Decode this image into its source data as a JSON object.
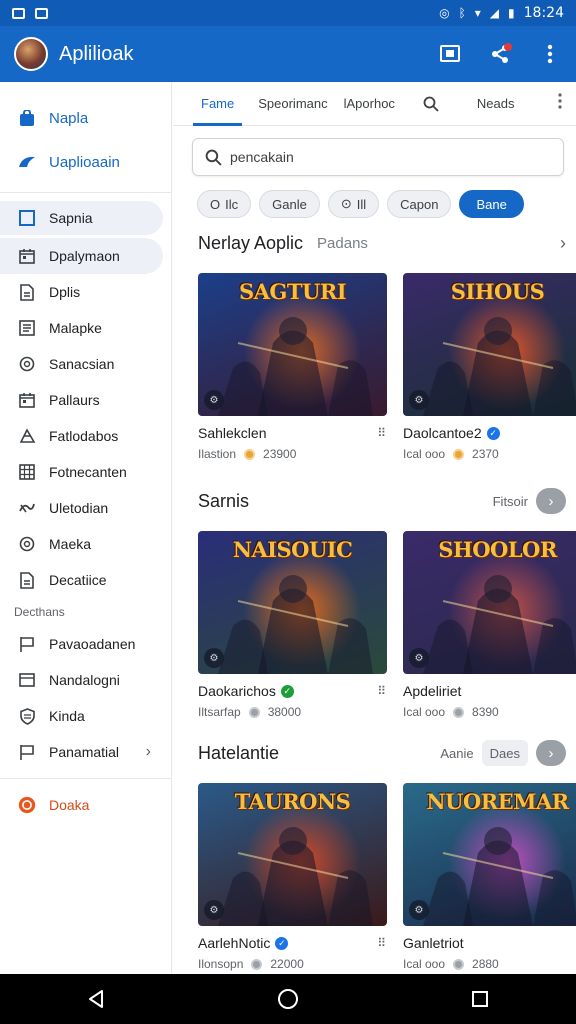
{
  "status_bar": {
    "time": "18:24"
  },
  "app_bar": {
    "title": "Aplilioak"
  },
  "sidebar": {
    "items_top": [
      {
        "label": "Napla",
        "icon": "bag-icon"
      },
      {
        "label": "Uaplioaain",
        "icon": "explore-icon"
      }
    ],
    "items_main": [
      {
        "label": "Sapnia",
        "icon": "square-icon"
      },
      {
        "label": "Dpalymaon",
        "icon": "calendar-icon"
      },
      {
        "label": "Dplis",
        "icon": "document-icon"
      },
      {
        "label": "Malapke",
        "icon": "list-icon"
      },
      {
        "label": "Sanacsian",
        "icon": "circle-icon"
      },
      {
        "label": "Pallaurs",
        "icon": "calendar-icon"
      },
      {
        "label": "Fatlodabos",
        "icon": "puzzle-icon"
      },
      {
        "label": "Fotnecanten",
        "icon": "grid-icon"
      },
      {
        "label": "Uletodian",
        "icon": "link-icon"
      },
      {
        "label": "Maeka",
        "icon": "circle-icon"
      },
      {
        "label": "Decatiice",
        "icon": "document-icon"
      }
    ],
    "section_label": "Decthans",
    "items_bottom": [
      {
        "label": "Pavaoadanen",
        "icon": "flag-icon"
      },
      {
        "label": "Nandalogni",
        "icon": "window-icon"
      },
      {
        "label": "Kinda",
        "icon": "shield-icon"
      },
      {
        "label": "Panamatial",
        "icon": "flag-icon"
      }
    ],
    "footer_item": {
      "label": "Doaka"
    }
  },
  "tabs": [
    {
      "label": "Fame"
    },
    {
      "label": "Speorimanc"
    },
    {
      "label": "lAporhoc"
    },
    {
      "label": "Neads"
    }
  ],
  "search": {
    "value": "pencakain"
  },
  "chips": [
    {
      "label": "Ilc",
      "prefix": "O"
    },
    {
      "label": "Ganle"
    },
    {
      "label": "Ill",
      "prefix": "⊙"
    },
    {
      "label": "Capon"
    },
    {
      "label": "Bane"
    }
  ],
  "sections": [
    {
      "title": "Nerlay Aoplic",
      "subtitle": "Padans",
      "more": "",
      "pill": "",
      "cards": [
        {
          "title": "Sahlekclen",
          "meta": "Ilastion",
          "count": "23900",
          "thumb_title": "SAGTURI",
          "colors": [
            "#1c3f8a",
            "#d8682a",
            "#3a1a2e"
          ],
          "verify": ""
        },
        {
          "title": "Daolcantoe2",
          "meta": "Ical ooo",
          "count": "2370",
          "thumb_title": "SIHOUS",
          "colors": [
            "#3a2a6a",
            "#e0562a",
            "#173030"
          ],
          "verify": "✓"
        }
      ]
    },
    {
      "title": "Sarnis",
      "subtitle": "",
      "more": "Fitsoir",
      "pill": "",
      "cards": [
        {
          "title": "Daokarichos",
          "meta": "Iltsarfap",
          "count": "38000",
          "thumb_title": "NAISOUIC",
          "colors": [
            "#2a2d7a",
            "#e06a1e",
            "#2a4a3a"
          ],
          "verify": "✓"
        },
        {
          "title": "Apdeliriet",
          "meta": "Ical ooo",
          "count": "8390",
          "thumb_title": "SHOOLOR",
          "colors": [
            "#3a2a6a",
            "#c0504a",
            "#2a2a4a"
          ],
          "verify": ""
        }
      ]
    },
    {
      "title": "Hatelantie",
      "subtitle": "",
      "more": "Aanie",
      "pill": "Daes",
      "cards": [
        {
          "title": "AarlehNotic",
          "meta": "Ilonsopn",
          "count": "22000",
          "thumb_title": "TAURONS",
          "colors": [
            "#2a5a8a",
            "#d04a2a",
            "#3a1a1a"
          ],
          "verify": "✓"
        },
        {
          "title": "Ganletriot",
          "meta": "Ical ooo",
          "count": "2880",
          "thumb_title": "NUOREMAR",
          "colors": [
            "#2a6a8a",
            "#c050c0",
            "#1a2a4a"
          ],
          "verify": ""
        }
      ]
    }
  ],
  "colors": {
    "primary": "#1668c7",
    "status_bar": "#0f5bb5",
    "accent_orange": "#d84b16"
  }
}
